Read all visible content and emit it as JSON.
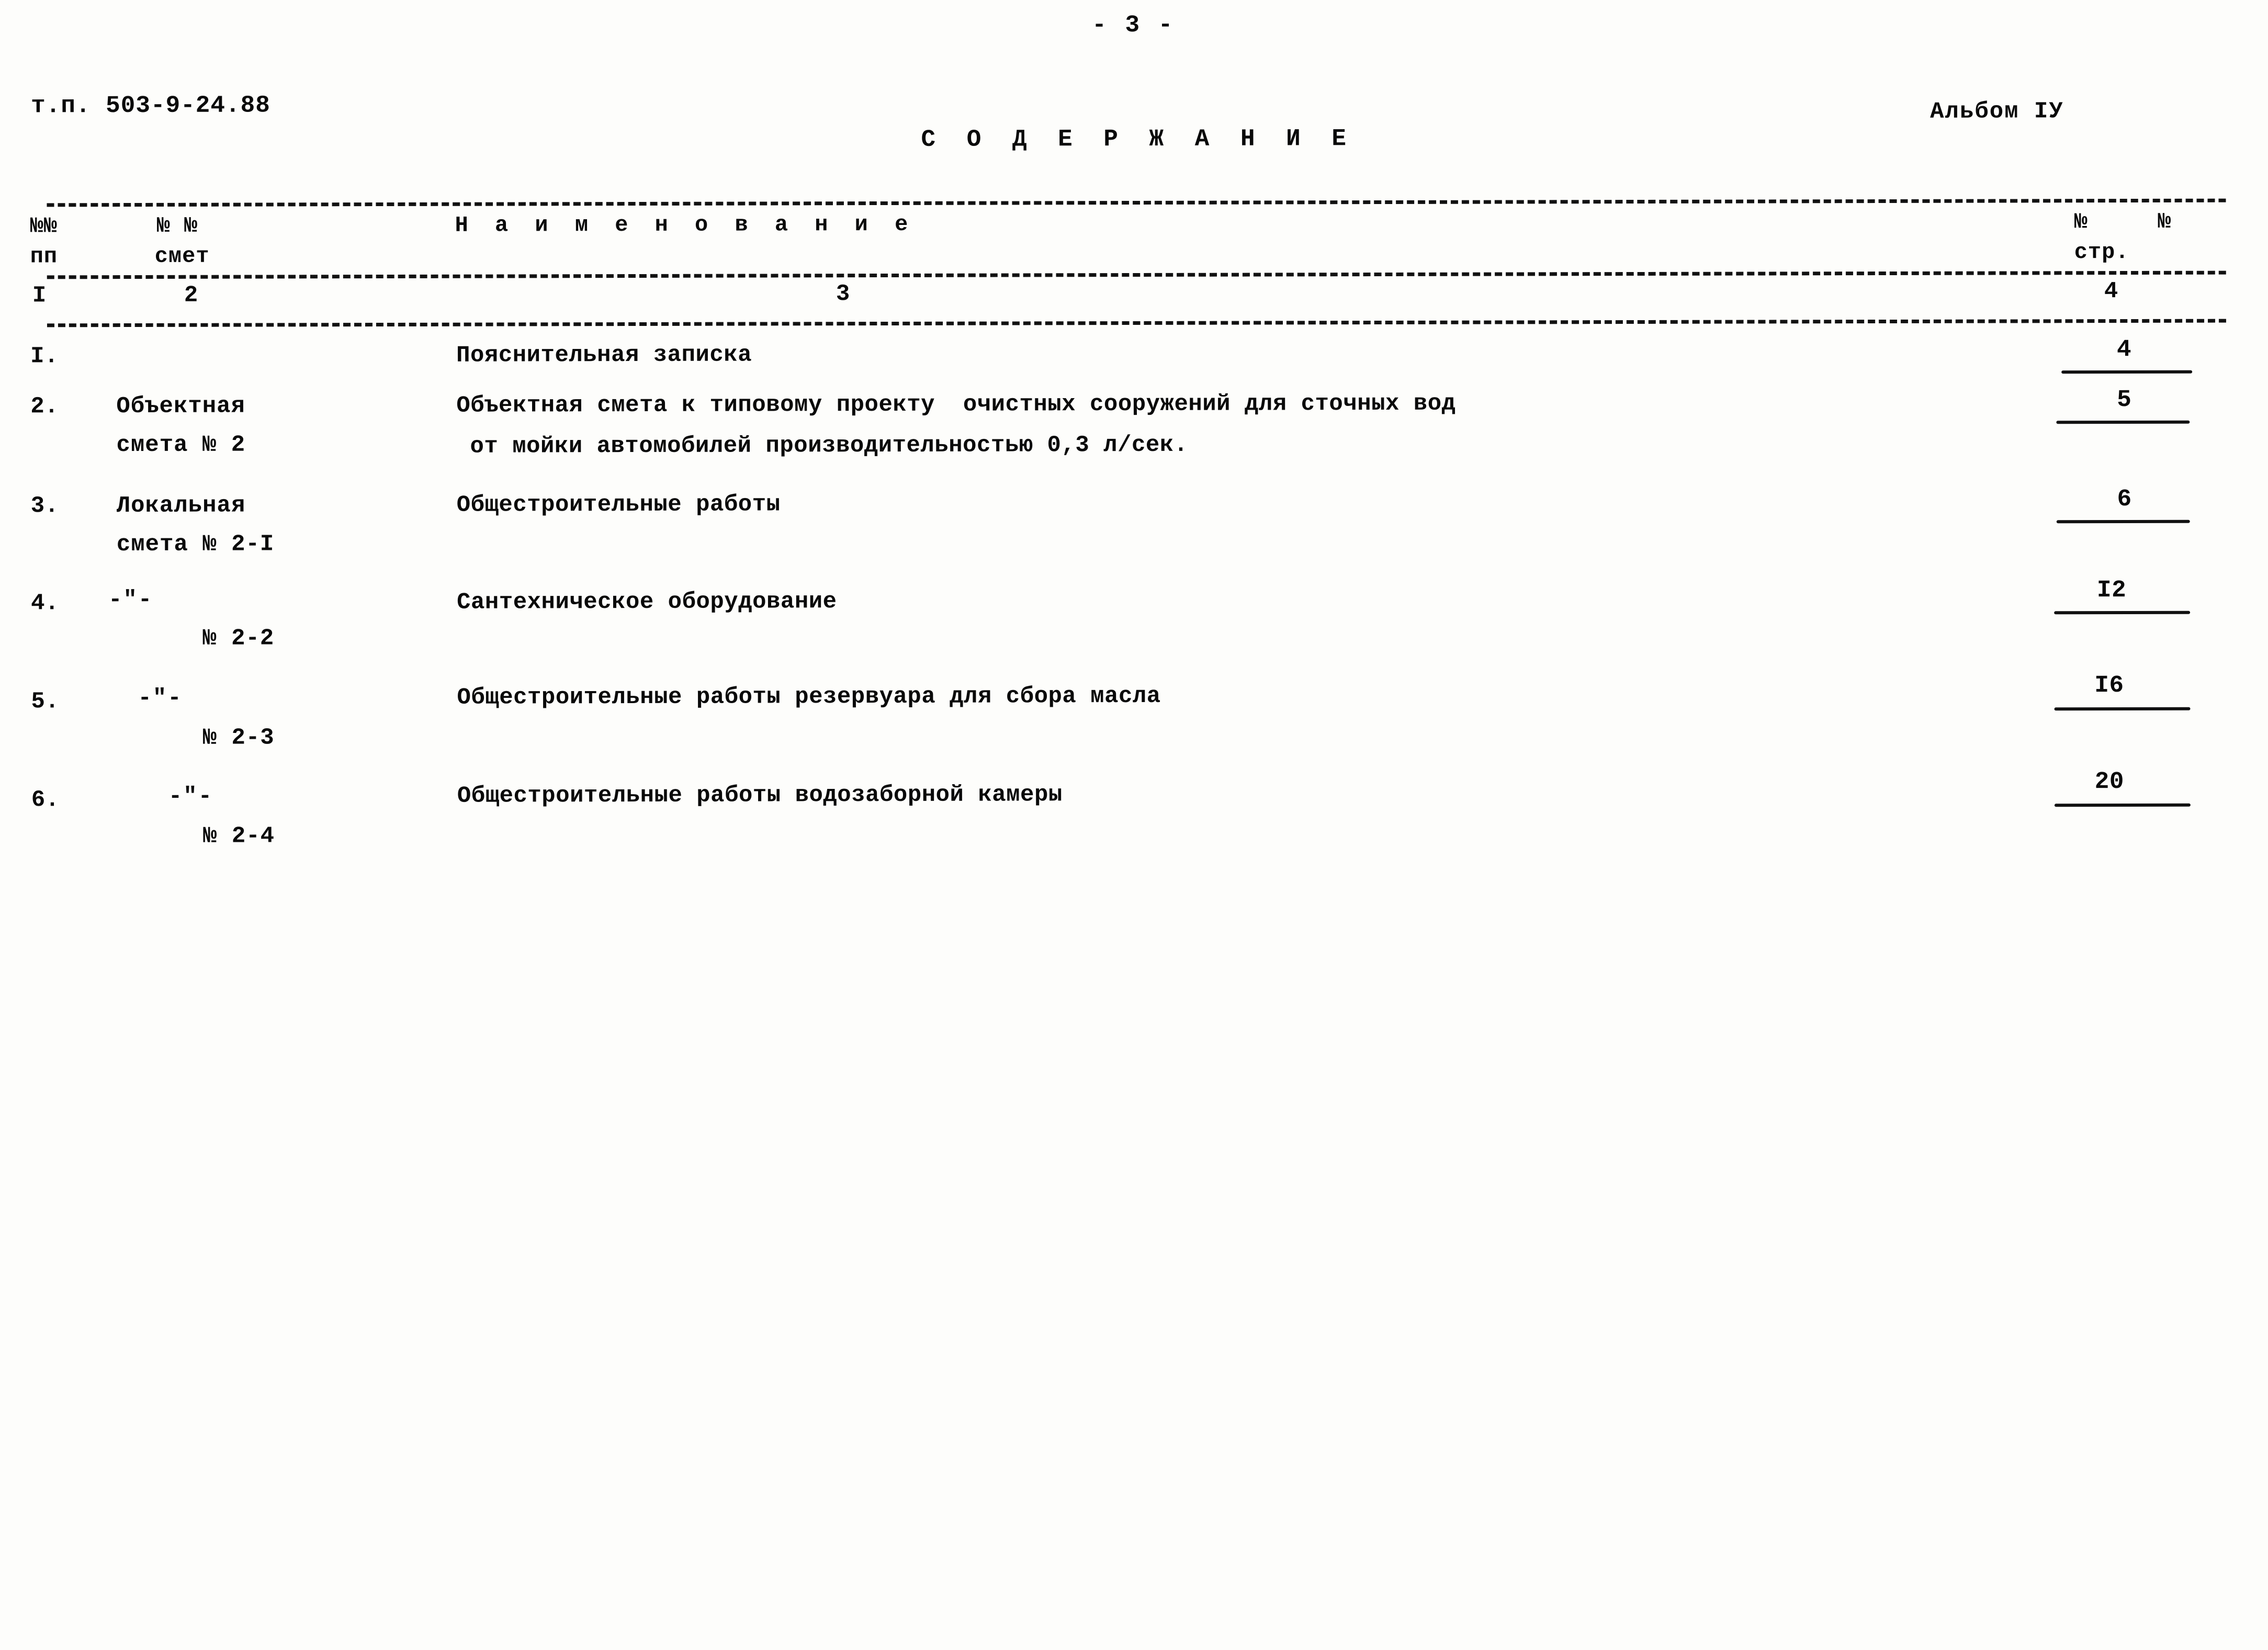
{
  "page": {
    "folio": "- 3 -",
    "doc_code": "т.п. 503-9-24.88",
    "album": "Альбом IУ",
    "title": "С О Д Е Р Ж А Н И Е"
  },
  "table": {
    "headers": {
      "col1_line1": "№№",
      "col1_line2": "пп",
      "col2_line1": "№ №",
      "col2_line2": "смет",
      "col3": "Н а и м е н о в а н и е",
      "col4_line1": "№  №",
      "col4_line2": "стр."
    },
    "column_numbers": {
      "col1": "I",
      "col2": "2",
      "col3": "3",
      "col4": "4"
    },
    "rows": [
      {
        "num": "I.",
        "smeta_line1": "",
        "smeta_line2": "",
        "ditto": "",
        "desc_line1": "Пояснительная записка",
        "desc_line2": "",
        "page": "4"
      },
      {
        "num": "2.",
        "smeta_line1": "Объектная",
        "smeta_line2": "смета № 2",
        "ditto": "",
        "desc_line1": "Объектная смета к типовому проекту  очистных сооружений для сточных вод",
        "desc_line2": "от мойки автомобилей производительностью 0,3 л/сек.",
        "page": "5"
      },
      {
        "num": "3.",
        "smeta_line1": "Локальная",
        "smeta_line2": "смета № 2-I",
        "ditto": "",
        "desc_line1": "Общестроительные работы",
        "desc_line2": "",
        "page": "6"
      },
      {
        "num": "4.",
        "smeta_line1": "",
        "smeta_line2": "№ 2-2",
        "ditto": "-\"-",
        "desc_line1": "Сантехническое оборудование",
        "desc_line2": "",
        "page": "I2"
      },
      {
        "num": "5.",
        "smeta_line1": "",
        "smeta_line2": "№ 2-3",
        "ditto": "-\"-",
        "desc_line1": "Общестроительные работы резервуара для сбора масла",
        "desc_line2": "",
        "page": "I6"
      },
      {
        "num": "6.",
        "smeta_line1": "",
        "smeta_line2": "№ 2-4",
        "ditto": "-\"-",
        "desc_line1": "Общестроительные работы водозаборной камеры",
        "desc_line2": "",
        "page": "20"
      }
    ]
  }
}
